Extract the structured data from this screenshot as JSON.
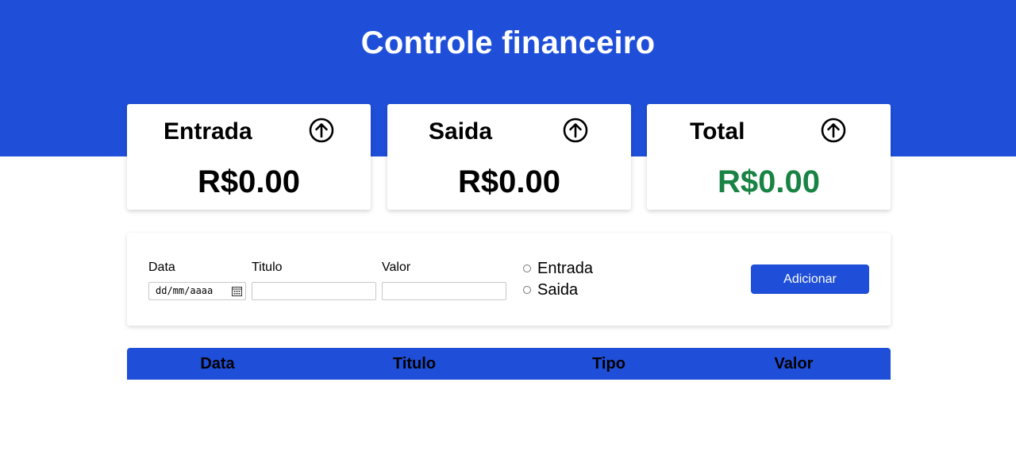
{
  "header": {
    "title": "Controle financeiro"
  },
  "colors": {
    "primary": "#1f4fd8",
    "total_positive": "#188343"
  },
  "cards": [
    {
      "label": "Entrada",
      "value": "R$0.00",
      "icon": "arrow-up-circle-icon"
    },
    {
      "label": "Saida",
      "value": "R$0.00",
      "icon": "arrow-up-circle-icon"
    },
    {
      "label": "Total",
      "value": "R$0.00",
      "icon": "arrow-up-circle-icon"
    }
  ],
  "form": {
    "date_label": "Data",
    "date_placeholder": "dd/mm/aaaa",
    "title_label": "Titulo",
    "title_value": "",
    "value_label": "Valor",
    "value_value": "",
    "radio_options": [
      "Entrada",
      "Saida"
    ],
    "submit_label": "Adicionar"
  },
  "table": {
    "columns": [
      "Data",
      "Titulo",
      "Tipo",
      "Valor"
    ],
    "rows": []
  }
}
